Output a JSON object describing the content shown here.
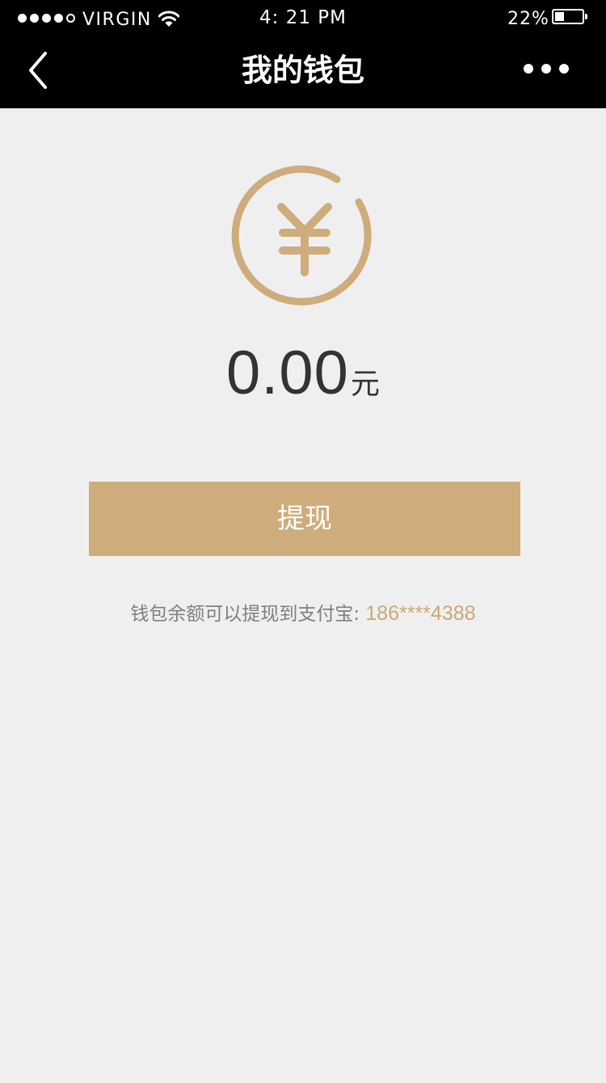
{
  "status_bar": {
    "carrier": "VIRGIN",
    "signal_bars_filled": 4,
    "signal_bars_total": 5,
    "time": "4: 21 PM",
    "battery_percent": "22%",
    "battery_level": 0.22
  },
  "nav": {
    "title": "我的钱包",
    "back_icon": "chevron-left-icon",
    "more_icon": "more-horizontal-icon"
  },
  "wallet": {
    "icon": "yuan-icon",
    "balance_amount": "0.00",
    "balance_unit": "元",
    "withdraw_label": "提现",
    "hint_text": "钱包余额可以提现到支付宝:",
    "hint_account": "186****4388"
  },
  "colors": {
    "nav_background": "#000000",
    "page_background": "#f0efef",
    "accent_gold": "#ceac7b",
    "balance_text": "#333333",
    "hint_text": "#7f7f7f"
  }
}
